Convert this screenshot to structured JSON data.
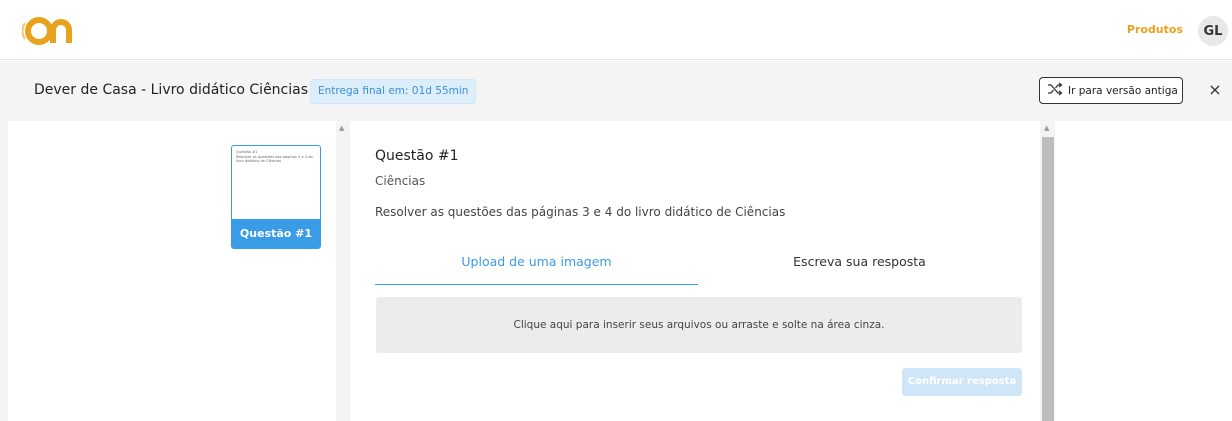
{
  "brand": {
    "logo_icon": "on-logo",
    "accent": "#e8a21e"
  },
  "topnav": {
    "products_label": "Produtos",
    "avatar_initials": "GL"
  },
  "subheader": {
    "title": "Dever de Casa - Livro didático Ciências",
    "deadline": "Entrega final em: 01d 55min",
    "old_version_label": "Ir para versão antiga",
    "close_icon": "×"
  },
  "sidebar": {
    "thumbnail_text": "Questão #1\nResolver as questões das páginas 3 e 4 do livro didático de Ciências",
    "thumbnail_label": "Questão #1"
  },
  "question": {
    "title": "Questão #1",
    "subject": "Ciências",
    "description": "Resolver as questões das páginas 3 e 4 do livro didático de Ciências"
  },
  "tabs": {
    "upload": "Upload de uma imagem",
    "write": "Escreva sua resposta"
  },
  "dropzone_text": "Clique aqui para inserir seus arquivos ou arraste e solte na área cinza.",
  "confirm_label": "Confirmar resposta",
  "colors": {
    "primary": "#3a9be6",
    "badge_bg": "#ddeefb"
  }
}
